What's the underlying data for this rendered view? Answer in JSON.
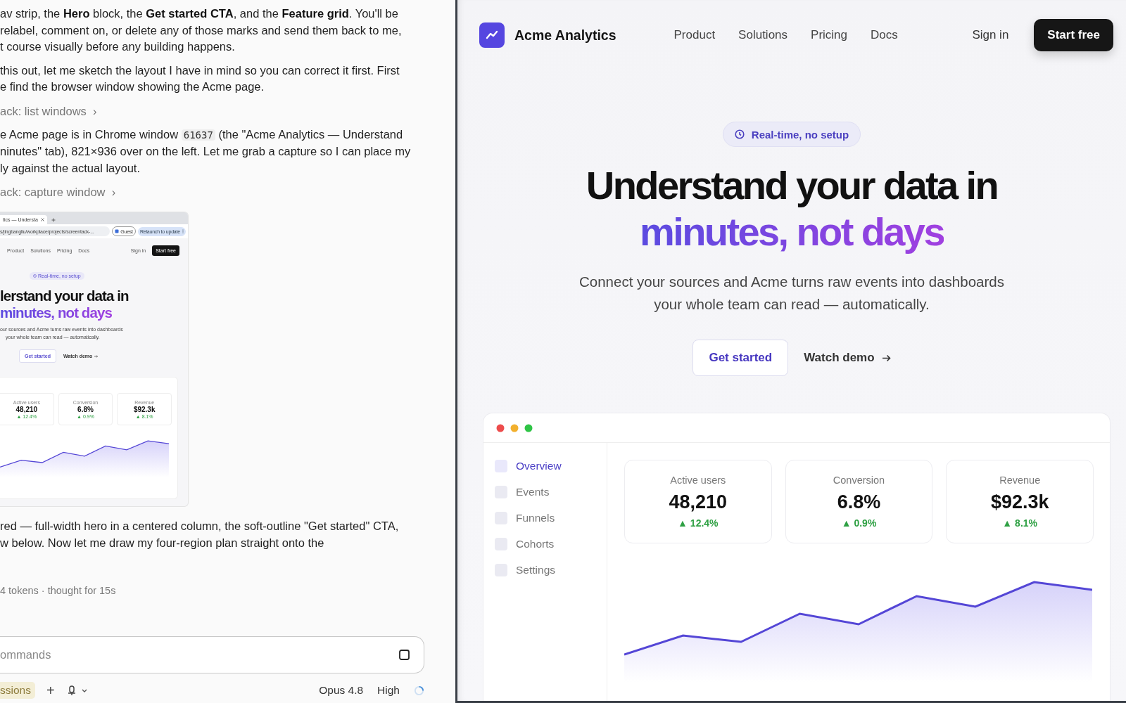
{
  "chat": {
    "blocks": [
      {
        "kind": "paragraph",
        "lines": [
          [
            {
              "kind": "plain",
              "text": "av strip, the "
            },
            {
              "kind": "bold",
              "text": "Hero"
            },
            {
              "kind": "plain",
              "text": " block, the "
            },
            {
              "kind": "bold",
              "text": "Get started CTA"
            },
            {
              "kind": "plain",
              "text": ", and the "
            },
            {
              "kind": "bold",
              "text": "Feature grid"
            },
            {
              "kind": "plain",
              "text": ". You'll be"
            }
          ],
          [
            {
              "kind": "plain",
              "text": "relabel, comment on, or delete any of those marks and send them back to me,"
            }
          ],
          [
            {
              "kind": "plain",
              "text": "t course visually before any building happens."
            }
          ]
        ]
      },
      {
        "kind": "paragraph",
        "lines": [
          [
            {
              "kind": "plain",
              "text": "this out, let me sketch the layout I have in mind so you can correct it first. First"
            }
          ],
          [
            {
              "kind": "plain",
              "text": "e find the browser window showing the Acme page."
            }
          ]
        ]
      },
      {
        "kind": "tool",
        "text": "ack: list windows",
        "chevron": "›"
      },
      {
        "kind": "paragraph",
        "lines": [
          [
            {
              "kind": "plain",
              "text": "e Acme page is in Chrome window "
            },
            {
              "kind": "code",
              "text": "61637"
            },
            {
              "kind": "plain",
              "text": " (the \"Acme Analytics — Understand"
            }
          ],
          [
            {
              "kind": "plain",
              "text": "ninutes\" tab), 821×936 over on the left. Let me grab a capture so I can place my"
            }
          ],
          [
            {
              "kind": "plain",
              "text": "ly against the actual layout."
            }
          ]
        ]
      },
      {
        "kind": "tool",
        "text": "ack: capture window",
        "chevron": "›"
      },
      {
        "kind": "capture"
      },
      {
        "kind": "paragraph",
        "lines": [
          [
            {
              "kind": "plain",
              "text": "red — full-width hero in a centered column, the soft-outline \"Get started\" CTA,"
            }
          ],
          [
            {
              "kind": "plain",
              "text": "w below. Now let me draw my four-region plan straight onto the"
            }
          ]
        ]
      },
      {
        "kind": "meta",
        "text": "4 tokens · thought for 15s"
      }
    ],
    "composer": {
      "placeholder": "ommands"
    },
    "footer": {
      "mode": "ssions",
      "add": "+",
      "model": "Opus 4.8",
      "effort": "High"
    }
  },
  "capture": {
    "tab": "tics — Understa",
    "url": "s/jingbangliu/workplace/projects/screentack-...",
    "profile": "Guest",
    "relaunch": "Relaunch to update",
    "nav": [
      "Product",
      "Solutions",
      "Pricing",
      "Docs"
    ],
    "sign_in": "Sign in",
    "cta": "Start free",
    "badge": "Real-time, no setup",
    "headline": "lerstand your data in",
    "headline_accent": "minutes, not days",
    "subtitle_lines": [
      "our sources and Acme turns raw events into dashboards",
      "your whole team can read — automatically."
    ],
    "primary": "Get started",
    "secondary": "Watch demo",
    "stats": [
      {
        "label": "Active users",
        "value": "48,210",
        "delta": "▲ 12.4%"
      },
      {
        "label": "Conversion",
        "value": "6.8%",
        "delta": "▲ 0.9%"
      },
      {
        "label": "Revenue",
        "value": "$92.3k",
        "delta": "▲ 8.1%"
      }
    ]
  },
  "site": {
    "brand": "Acme Analytics",
    "nav": [
      "Product",
      "Solutions",
      "Pricing",
      "Docs"
    ],
    "sign_in": "Sign in",
    "cta": "Start free",
    "badge": "Real-time, no setup",
    "headline": "Understand your data in",
    "headline_accent": "minutes, not days",
    "subtitle_lines": [
      "Connect your sources and Acme turns raw events into dashboards",
      "your whole team can read — automatically."
    ],
    "primary": "Get started",
    "secondary": "Watch demo",
    "dashboard": {
      "sidebar": [
        {
          "label": "Overview",
          "selected": true
        },
        {
          "label": "Events",
          "selected": false
        },
        {
          "label": "Funnels",
          "selected": false
        },
        {
          "label": "Cohorts",
          "selected": false
        },
        {
          "label": "Settings",
          "selected": false
        }
      ],
      "stats": [
        {
          "label": "Active users",
          "value": "48,210",
          "delta": "▲ 12.4%"
        },
        {
          "label": "Conversion",
          "value": "6.8%",
          "delta": "▲ 0.9%"
        },
        {
          "label": "Revenue",
          "value": "$92.3k",
          "delta": "▲ 8.1%"
        }
      ]
    }
  }
}
